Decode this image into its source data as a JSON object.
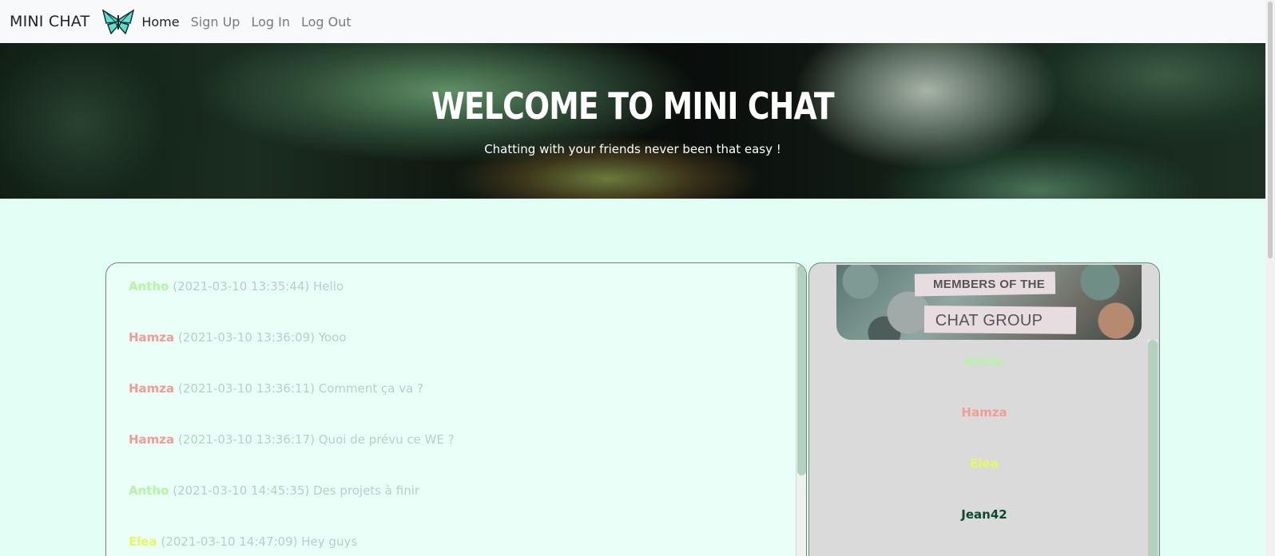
{
  "navbar": {
    "brand": "MINI CHAT",
    "logo_icon": "butterfly-icon",
    "links": [
      {
        "label": "Home",
        "active": true
      },
      {
        "label": "Sign Up",
        "active": false
      },
      {
        "label": "Log In",
        "active": false
      },
      {
        "label": "Log Out",
        "active": false
      }
    ]
  },
  "hero": {
    "title": "WELCOME TO MINI CHAT",
    "subtitle": "Chatting with your friends never been that easy !"
  },
  "chat": {
    "messages": [
      {
        "user": "Antho",
        "timestamp": "(2021-03-10 13:35:44)",
        "text": "Hello",
        "user_color": "#b2f5a2"
      },
      {
        "user": "Hamza",
        "timestamp": "(2021-03-10 13:36:09)",
        "text": "Yooo",
        "user_color": "#f49b95"
      },
      {
        "user": "Hamza",
        "timestamp": "(2021-03-10 13:36:11)",
        "text": "Comment ça va ?",
        "user_color": "#f49b95"
      },
      {
        "user": "Hamza",
        "timestamp": "(2021-03-10 13:36:17)",
        "text": "Quoi de prévu ce WE ?",
        "user_color": "#f49b95"
      },
      {
        "user": "Antho",
        "timestamp": "(2021-03-10 14:45:35)",
        "text": "Des projets à finir",
        "user_color": "#b2f5a2"
      },
      {
        "user": "Elea",
        "timestamp": "(2021-03-10 14:47:09)",
        "text": "Hey guys",
        "user_color": "#e6fa5e"
      }
    ]
  },
  "members": {
    "header_line1": "MEMBERS OF THE",
    "header_line2": "CHAT GROUP",
    "list": [
      {
        "name": "Antho",
        "color": "#b2f5a2"
      },
      {
        "name": "Hamza",
        "color": "#f49b95"
      },
      {
        "name": "Elea",
        "color": "#e6fa5e"
      },
      {
        "name": "Jean42",
        "color": "#0b4a2c"
      }
    ]
  },
  "colors": {
    "page_background": "#e2fff6",
    "chat_background": "#e9fff8",
    "members_background": "#dadada",
    "scroll_thumb": "#b3d1be"
  }
}
